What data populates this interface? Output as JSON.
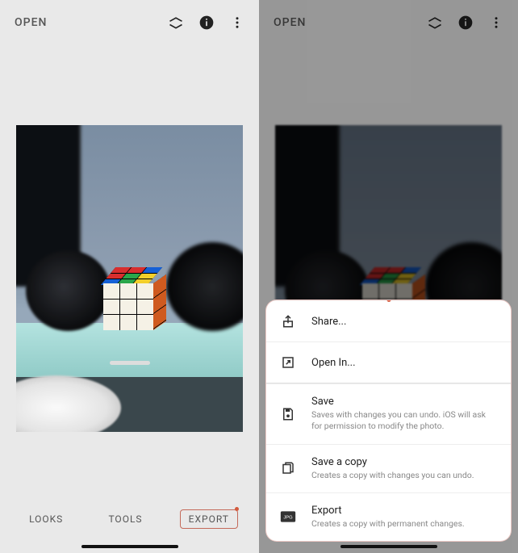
{
  "left": {
    "open_label": "OPEN",
    "tabs": {
      "looks": "LOOKS",
      "tools": "TOOLS",
      "export": "EXPORT"
    }
  },
  "right": {
    "open_label": "OPEN",
    "sheet": {
      "share": {
        "title": "Share..."
      },
      "open_in": {
        "title": "Open In..."
      },
      "save": {
        "title": "Save",
        "subtitle": "Saves with changes you can undo. iOS will ask for permission to modify the photo."
      },
      "save_copy": {
        "title": "Save a copy",
        "subtitle": "Creates a copy with changes you can undo."
      },
      "export": {
        "title": "Export",
        "subtitle": "Creates a copy with permanent changes."
      }
    }
  }
}
